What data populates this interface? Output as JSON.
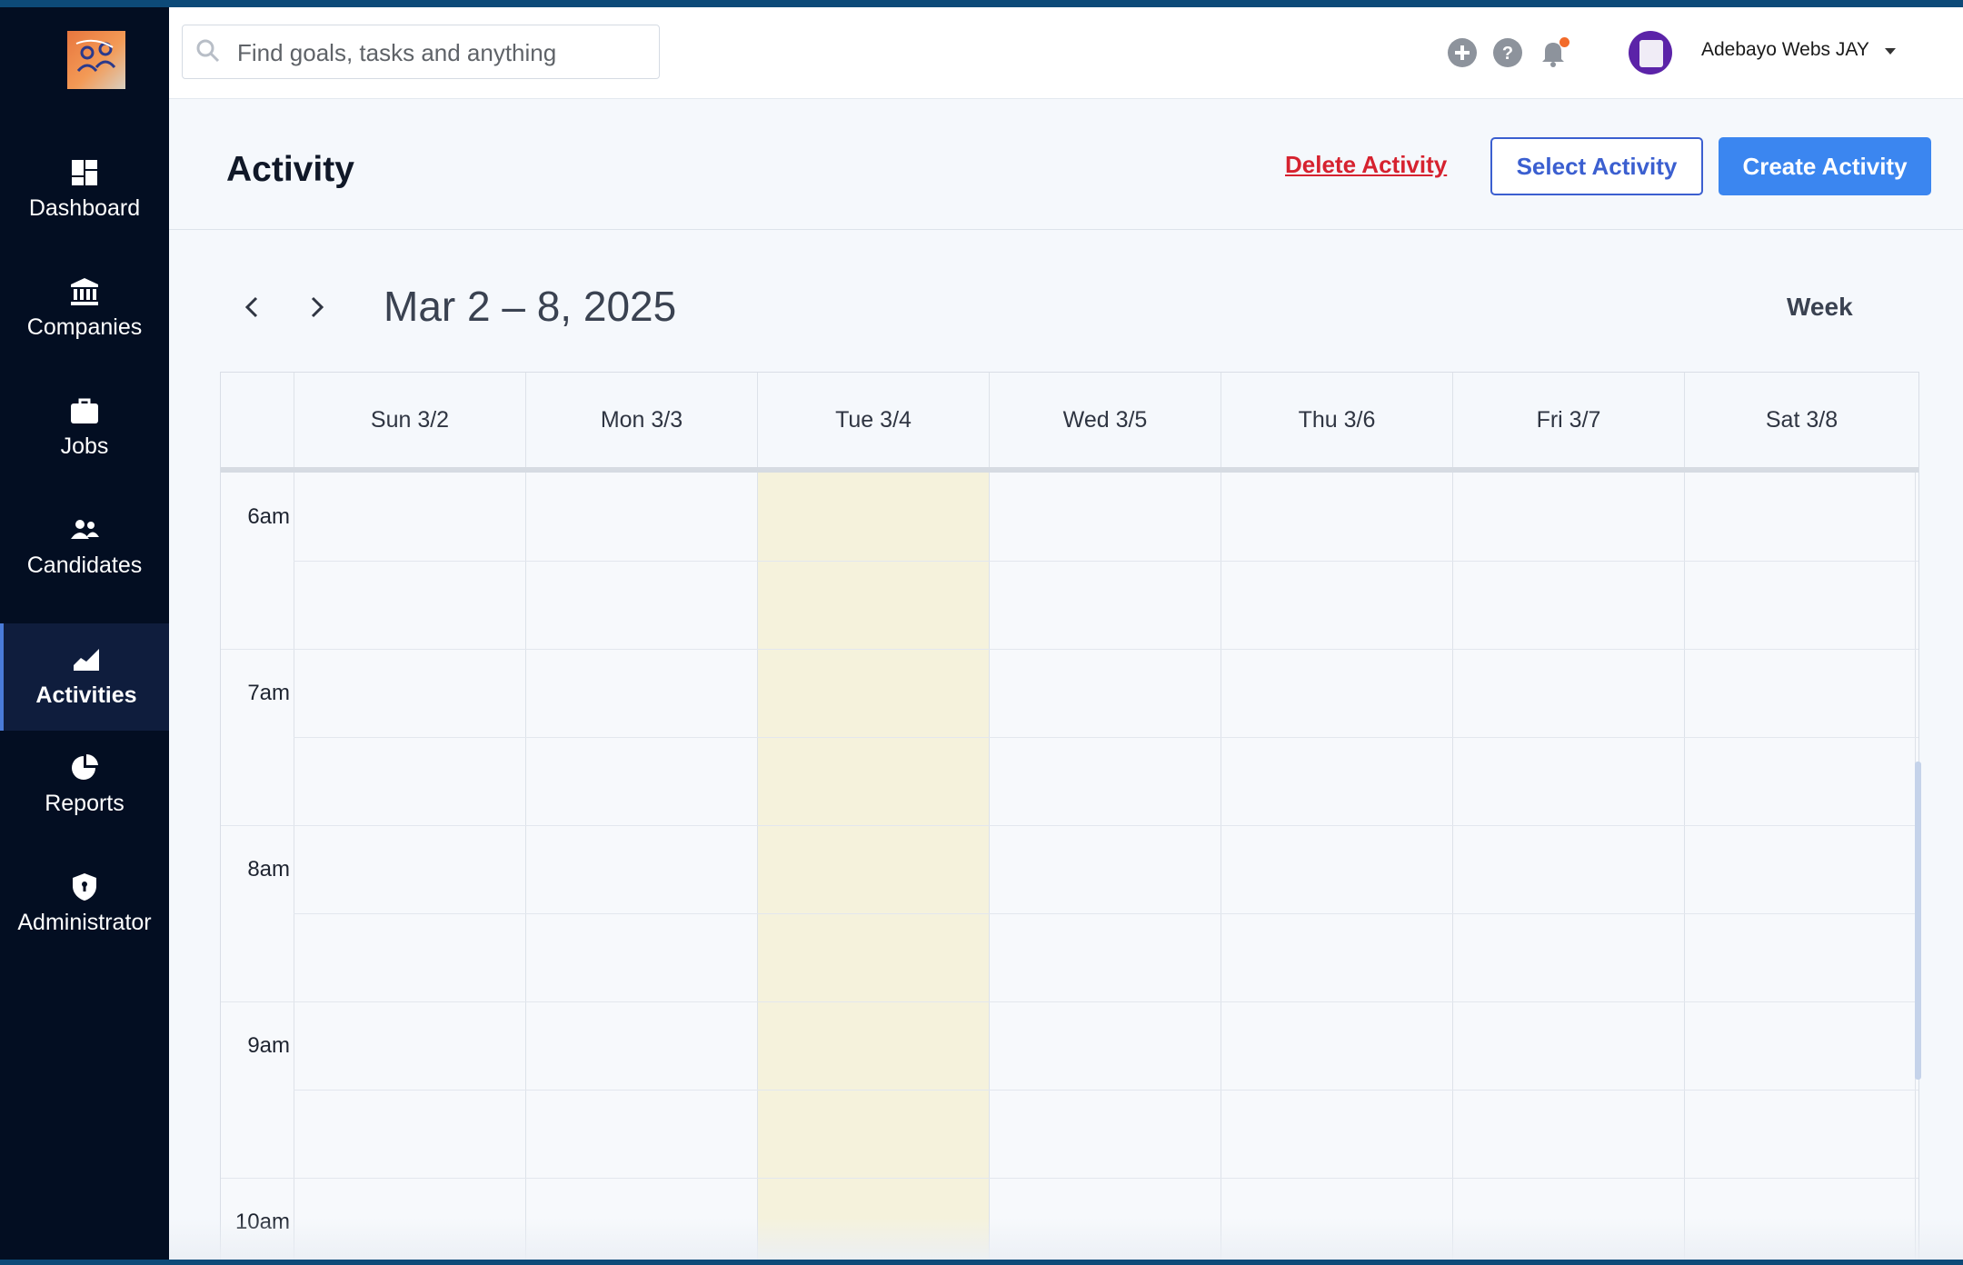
{
  "sidebar": {
    "items": [
      {
        "label": "Dashboard",
        "icon": "dashboard-icon"
      },
      {
        "label": "Companies",
        "icon": "bank-icon"
      },
      {
        "label": "Jobs",
        "icon": "briefcase-icon"
      },
      {
        "label": "Candidates",
        "icon": "people-icon"
      },
      {
        "label": "Activities",
        "icon": "area-chart-icon",
        "active": true
      },
      {
        "label": "Reports",
        "icon": "pie-chart-icon"
      },
      {
        "label": "Administrator",
        "icon": "shield-icon"
      }
    ]
  },
  "search": {
    "placeholder": "Find goals, tasks and anything",
    "value": ""
  },
  "user": {
    "name": "Adebayo Webs JAY"
  },
  "page": {
    "title": "Activity",
    "delete_label": "Delete Activity",
    "select_label": "Select Activity",
    "create_label": "Create Activity"
  },
  "calendar": {
    "range": "Mar 2 – 8, 2025",
    "view": "Week",
    "days": [
      "Sun 3/2",
      "Mon 3/3",
      "Tue 3/4",
      "Wed 3/5",
      "Thu 3/6",
      "Fri 3/7",
      "Sat 3/8"
    ],
    "today": "Tue 3/4",
    "times": [
      "6am",
      "7am",
      "8am",
      "9am",
      "10am"
    ]
  },
  "colors": {
    "sidebar_bg": "#030e22",
    "accent_blue": "#3b86f0",
    "danger_red": "#d6222f",
    "today_highlight": "#f5f2dc",
    "notification_dot": "#f26b2a"
  }
}
